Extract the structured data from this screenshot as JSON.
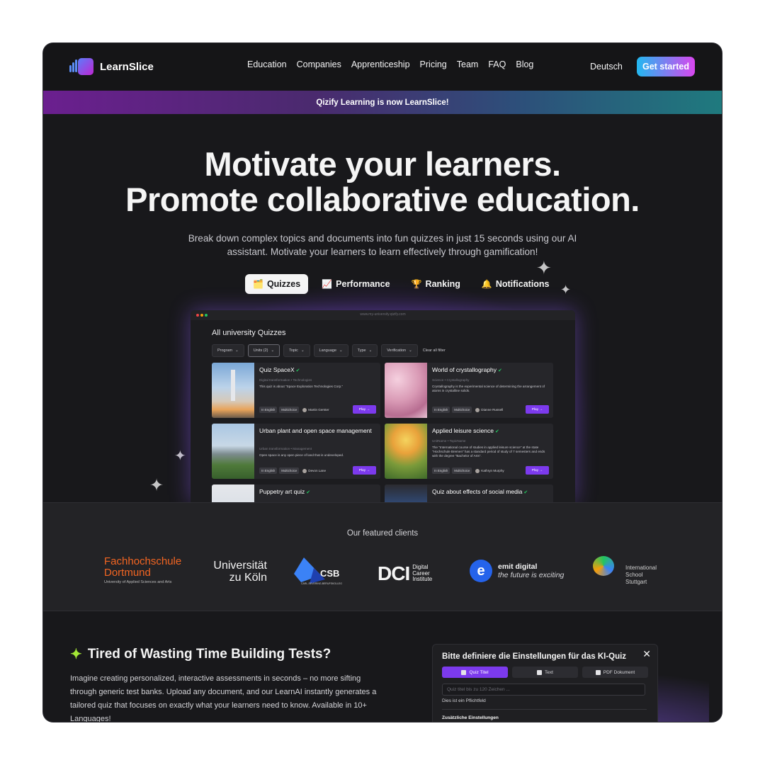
{
  "nav": {
    "brand": "LearnSlice",
    "links": [
      "Education",
      "Companies",
      "Apprenticeship",
      "Pricing",
      "Team",
      "FAQ",
      "Blog"
    ],
    "language": "Deutsch",
    "cta": "Get started"
  },
  "banner": "Qizify Learning is now LearnSlice!",
  "hero": {
    "title_line1": "Motivate your learners.",
    "title_line2": "Promote collaborative education.",
    "subtitle": "Break down complex topics and documents into fun quizzes in just 15 seconds using our AI assistant. Motivate your learners to learn effectively through gamification!",
    "tabs": [
      {
        "icon": "🗂️",
        "label": "Quizzes",
        "active": true
      },
      {
        "icon": "📈",
        "label": "Performance"
      },
      {
        "icon": "🏆",
        "label": "Ranking"
      },
      {
        "icon": "🔔",
        "label": "Notifications"
      }
    ]
  },
  "app": {
    "url": "www.my-university.qizify.com",
    "title": "All university Quizzes",
    "filters": [
      "Program",
      "Units (2)",
      "Topic",
      "Language",
      "Type",
      "Verification"
    ],
    "clear": "Clear all filter",
    "play_label": "Play →",
    "cards": [
      {
        "title": "Quiz SpaceX",
        "meta": "Digital transformation • Technologies",
        "desc": "This quiz is about \"Space Exploration Technologies Corp.\"",
        "chips": [
          "In English",
          "Multichoice"
        ],
        "author": "Martin Gerster"
      },
      {
        "title": "World of crystallography",
        "meta": "Science • Crystallography",
        "desc": "Crystallography is the experimental science of determining the arrangement of atoms in crystalline solids.",
        "chips": [
          "In English",
          "Multichoice"
        ],
        "author": "Dianne Russell"
      },
      {
        "title": "Urban plant and open space management",
        "meta": "Urban transformation • Management",
        "desc": "Open space is any open piece of land that is undeveloped.",
        "chips": [
          "In English",
          "Multichoice"
        ],
        "author": "Devon Lane"
      },
      {
        "title": "Applied leisure science",
        "meta": "UnitName • TopicName",
        "desc": "The \"International course of studies in applied leisure science\" at the state \"Hochschule Bremen\" has a standard period of study of 7 semesters and ends with the degree \"Bachelor of Arts\".",
        "chips": [
          "In English",
          "Multichoice"
        ],
        "author": "Kathryn Murphy"
      },
      {
        "title": "Puppetry art quiz",
        "meta": "",
        "desc": "",
        "chips": [],
        "author": ""
      },
      {
        "title": "Quiz about effects of social media",
        "meta": "",
        "desc": "",
        "chips": [],
        "author": ""
      }
    ]
  },
  "clients": {
    "heading": "Our featured clients",
    "logos": {
      "fh_line1": "Fachhochschule",
      "fh_line2": "Dortmund",
      "fh_sub": "University of Applied Sciences and Arts",
      "uk_line1": "Universität",
      "uk_line2": "zu Köln",
      "csb": "CSB",
      "csb_sub": "CARL-SEVERING-BERUFSKOLLEG",
      "dci_mark": "DCI",
      "dci_line1": "Digital",
      "dci_line2": "Career",
      "dci_line3": "Institute",
      "emit_name": "emit digital",
      "emit_tag": "the future is exciting",
      "iss_line1": "International",
      "iss_line2": "School",
      "iss_line3": "Stuttgart"
    }
  },
  "feature": {
    "heading": "Tired of Wasting Time Building Tests?",
    "body": "Imagine creating personalized, interactive assessments in seconds – no more sifting through generic test banks. Upload any document, and our LearnAI instantly generates a tailored quiz that focuses on exactly what your learners need to know. Available in 10+ Languages!"
  },
  "ki_dialog": {
    "title": "Bitte definiere die Einstellungen für das KI-Quiz",
    "tabs": [
      "Quiz Titel",
      "Text",
      "PDF Dokument"
    ],
    "input_placeholder": "Quiz titel bis zu 120 Zeichen ...",
    "required_note": "Dies ist ein Pflichtfeld",
    "section": "Zusätzliche Einstellungen"
  },
  "colors": {
    "accent": "#7c3aed",
    "cta_from": "#22b8f0",
    "cta_to": "#d946ef",
    "verified": "#22c55e"
  }
}
